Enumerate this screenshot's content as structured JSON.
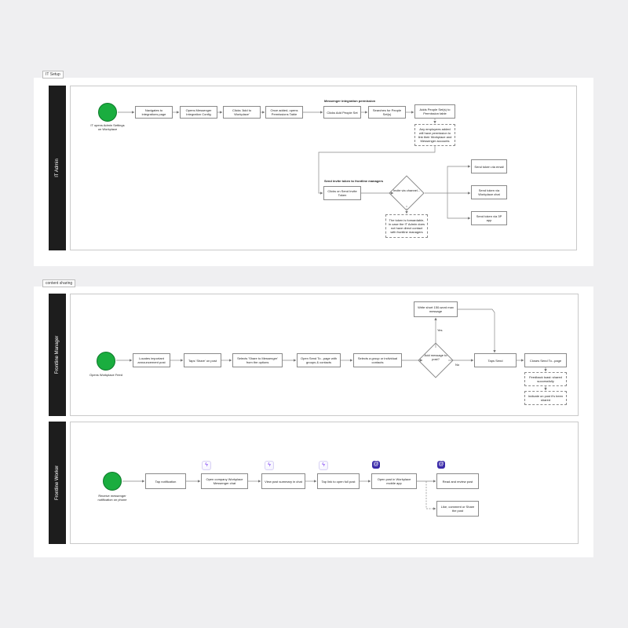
{
  "frames": [
    {
      "tag": "IT Setup",
      "lanes": [
        {
          "label": "IT Admin",
          "start_caption": "IT opens Admin Settings on Workplace",
          "steps": [
            "Navigates to integrations page",
            "Opens Messenger Integration Config",
            "Clicks 'Add to Workplace'",
            "Once added, opens Permissions Table",
            "Clicks Add People Set",
            "Searches for People Set(s)",
            "Adds People Set(s) to Permission table"
          ],
          "group1_title": "Messenger integration permission",
          "note1": "Any employees added will have permission to link their Workplace and Messenger accounts",
          "group2_title": "Send invite token to frontline managers",
          "step8": "Clicks on Send Invite Token",
          "decision": "Invite via channel...",
          "note2": "The token is forwardable, in case the IT Admin does not have direct contact with frontline managers",
          "outcomes": [
            "Send token via email",
            "Send token via Workplace chat",
            "Send token via 3P app"
          ]
        }
      ]
    },
    {
      "tag": "content sharing",
      "lanes": [
        {
          "label": "Frontline Manager",
          "start_caption": "Opens Workplace Feed",
          "steps": [
            "Locates important announcement post",
            "Taps 'Share' on post",
            "Selects 'Share to Messenger' from the options",
            "Open Send To...page with groups & contacts",
            "Selects a group or individual contacts"
          ],
          "decision": "Add message to post?",
          "yes_label": "Yes",
          "no_label": "No",
          "message_box": "Write short 150-word max message",
          "tap_send": "Taps Send",
          "close_box": "Closes Send To...page",
          "feedback": [
            "Feedback toast: shared successfully",
            "Indicate on post it's been shared"
          ]
        },
        {
          "label": "Frontline Worker",
          "start_caption": "Receive messenger notification on phone",
          "steps": [
            "Tap notification",
            "Open company Workplace Messenger chat",
            "View post summary in chat",
            "Tap link to open full post",
            "Open post in Workplace mobile app",
            "Read and review post"
          ],
          "branch": "Like, comment or Share the post",
          "icons": [
            "messenger-icon",
            "messenger-icon",
            "messenger-icon",
            "workplace-icon",
            "workplace-icon"
          ]
        }
      ]
    }
  ],
  "colors": {
    "start": "#1aad3f",
    "lane_label": "#1d1d1d",
    "messenger": "#7b3cf2",
    "workplace": "#3a2aa8"
  }
}
